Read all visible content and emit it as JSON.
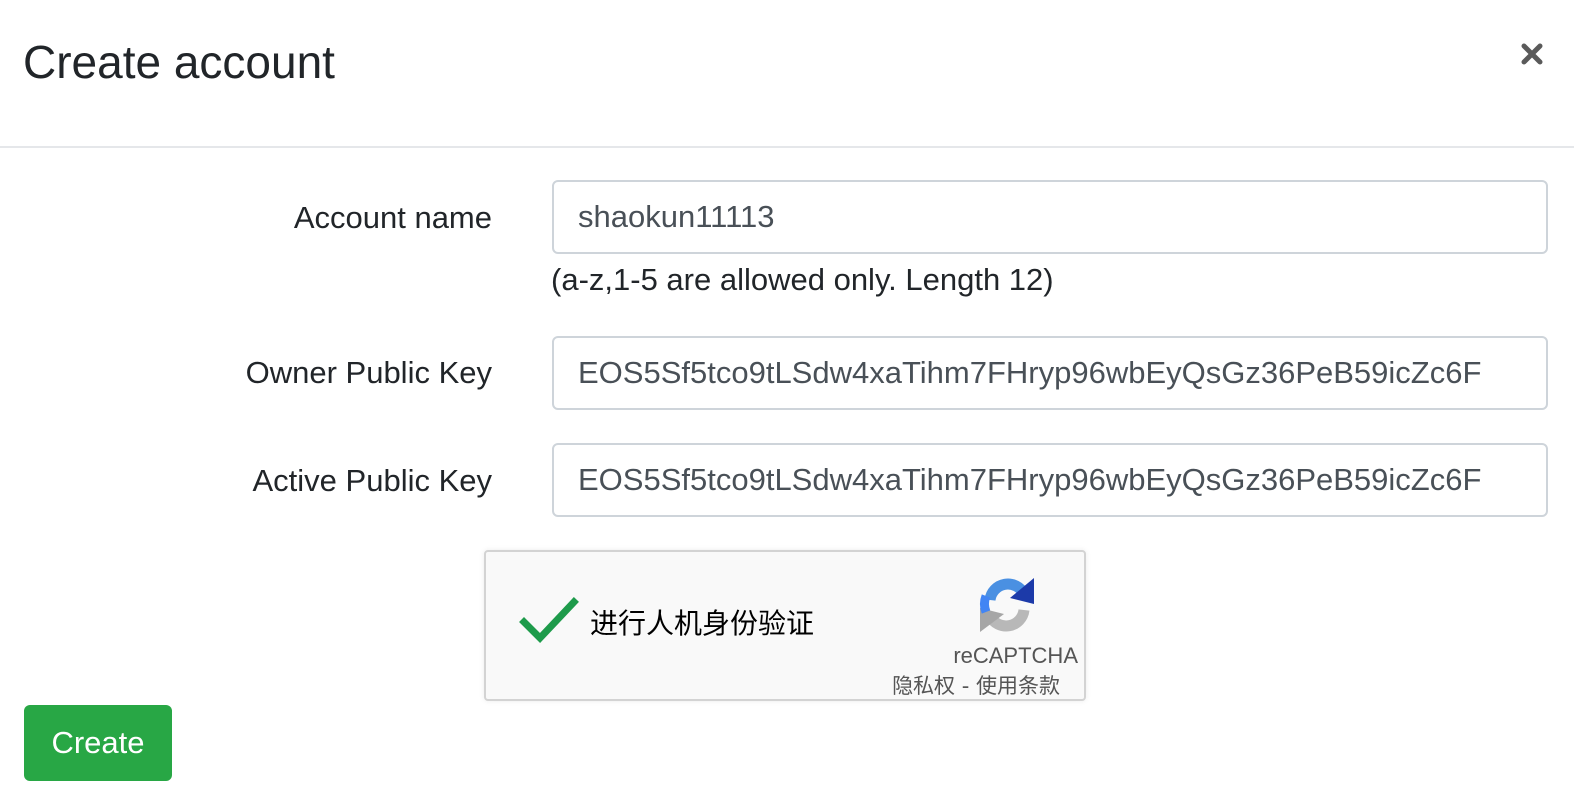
{
  "modal": {
    "title": "Create account",
    "close_icon": "close-icon"
  },
  "form": {
    "account_name": {
      "label": "Account name",
      "value": "shaokun11113",
      "help": "(a-z,1-5 are allowed only. Length 12)"
    },
    "owner_key": {
      "label": "Owner Public Key",
      "value": "EOS5Sf5tco9tLSdw4xaTihm7FHryp96wbEyQsGz36PeB59icZc6F"
    },
    "active_key": {
      "label": "Active Public Key",
      "value": "EOS5Sf5tco9tLSdw4xaTihm7FHryp96wbEyQsGz36PeB59icZc6F"
    }
  },
  "recaptcha": {
    "label": "进行人机身份验证",
    "brand": "reCAPTCHA",
    "privacy": "隐私权",
    "separator": " - ",
    "terms": "使用条款",
    "state": "checked",
    "check_icon": "checkmark-icon",
    "logo_icon": "recaptcha-logo-icon",
    "check_color": "#1e9b4b"
  },
  "actions": {
    "create_label": "Create",
    "create_color": "#28a745"
  }
}
